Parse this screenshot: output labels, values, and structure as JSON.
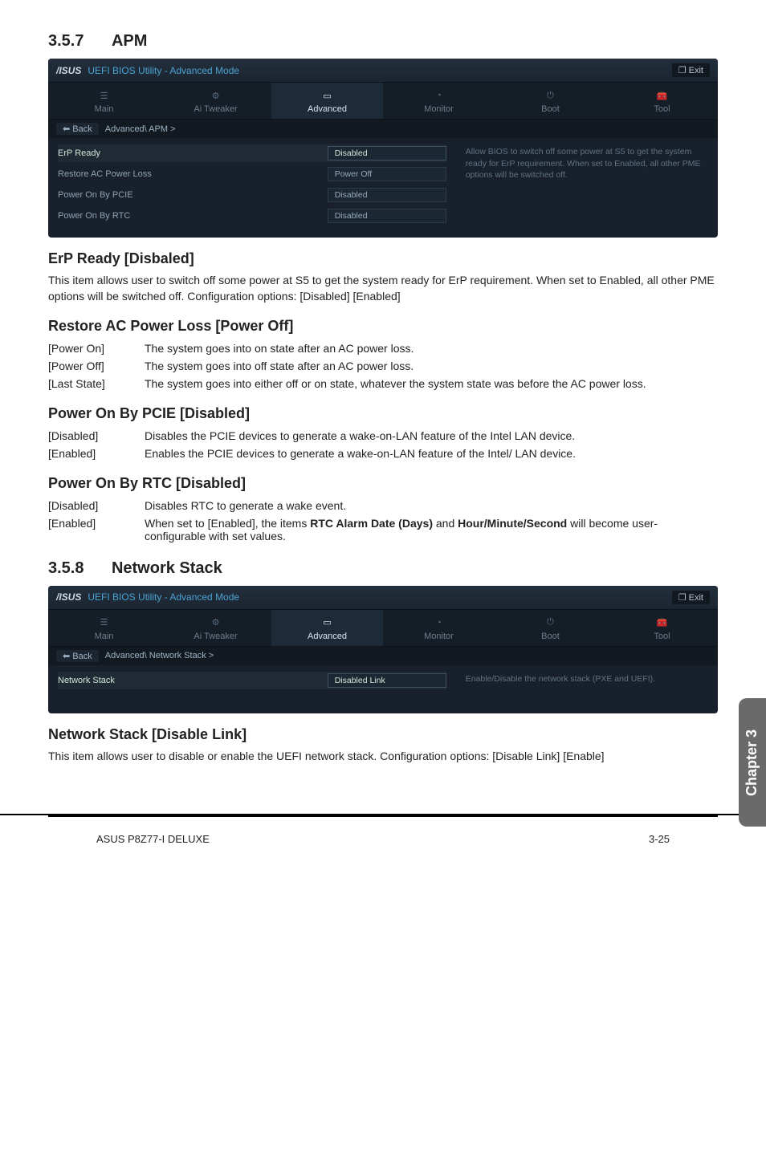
{
  "section_357": {
    "num": "3.5.7",
    "title": "APM"
  },
  "section_358": {
    "num": "3.5.8",
    "title": "Network Stack"
  },
  "bios1": {
    "logo": "/ISUS",
    "utility_title": "UEFI BIOS Utility - Advanced Mode",
    "exit": "Exit",
    "tabs": {
      "main": "Main",
      "ai": "Ai  Tweaker",
      "adv": "Advanced",
      "mon": "Monitor",
      "boot": "Boot",
      "tool": "Tool"
    },
    "back": "Back",
    "crumb": "Advanced\\ APM  >",
    "rows": {
      "erp": {
        "label": "ErP Ready",
        "val": "Disabled"
      },
      "restore": {
        "label": "Restore AC Power Loss",
        "val": "Power Off"
      },
      "pcie": {
        "label": "Power On By PCIE",
        "val": "Disabled"
      },
      "rtc": {
        "label": "Power On By RTC",
        "val": "Disabled"
      }
    },
    "help": "Allow BIOS to switch off some power at S5 to get the system ready for ErP requirement. When set to Enabled, all other PME options will be switched off."
  },
  "bios2": {
    "logo": "/ISUS",
    "utility_title": "UEFI BIOS Utility - Advanced Mode",
    "exit": "Exit",
    "tabs": {
      "main": "Main",
      "ai": "Ai  Tweaker",
      "adv": "Advanced",
      "mon": "Monitor",
      "boot": "Boot",
      "tool": "Tool"
    },
    "back": "Back",
    "crumb": "Advanced\\ Network Stack  >",
    "rows": {
      "ns": {
        "label": "Network Stack",
        "val": "Disabled Link"
      }
    },
    "help": "Enable/Disable the network stack (PXE and UEFI)."
  },
  "erp": {
    "head": "ErP Ready [Disbaled]",
    "text": "This item allows user to switch off some power at S5 to get the system ready for ErP requirement. When set to Enabled, all other PME options will be switched off. Configuration options: [Disabled] [Enabled]"
  },
  "restore": {
    "head": "Restore AC Power Loss [Power Off]",
    "row1k": "[Power On]",
    "row1v": "The system goes into on state after an AC power loss.",
    "row2k": "[Power Off]",
    "row2v": "The system goes into off state after an AC power loss.",
    "row3k": "[Last State]",
    "row3v": "The system goes into either off or on state, whatever the system state was before the AC power loss."
  },
  "pcie": {
    "head": "Power On By PCIE [Disabled]",
    "row1k": "[Disabled]",
    "row1v": "Disables the PCIE devices to generate a wake-on-LAN feature of the Intel LAN device.",
    "row2k": "[Enabled]",
    "row2v": "Enables the PCIE devices to generate a wake-on-LAN feature of the Intel/ LAN device."
  },
  "rtc": {
    "head": "Power On By RTC [Disabled]",
    "row1k": "[Disabled]",
    "row1v": "Disables RTC to generate a wake event.",
    "row2k": "[Enabled]",
    "row2v_pre": "When set to [Enabled], the items ",
    "row2v_b1": "RTC Alarm Date (Days)",
    "row2v_mid": " and ",
    "row2v_b2": "Hour/Minute/Second",
    "row2v_post": " will become user-configurable with set values."
  },
  "netstack": {
    "head": "Network Stack [Disable Link]",
    "text": "This item allows user to disable or enable the UEFI network stack. Configuration options: [Disable Link] [Enable]"
  },
  "sidebar": "Chapter 3",
  "footer": {
    "left": "ASUS P8Z77-I DELUXE",
    "right": "3-25"
  }
}
